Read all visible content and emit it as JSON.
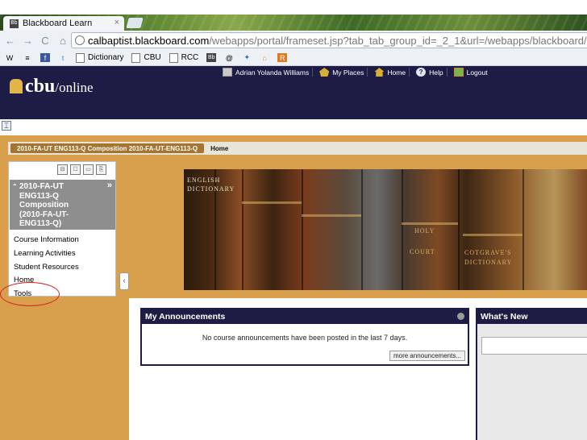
{
  "browser": {
    "tab_title": "Blackboard Learn",
    "tab_close": "×",
    "url_domain": "calbaptist.blackboard.com",
    "url_path": "/webapps/portal/frameset.jsp?tab_tab_group_id=_2_1&url=/webapps/blackboard/execute/launc",
    "nav": {
      "back": "←",
      "forward": "→",
      "reload": "C",
      "home": "⌂"
    },
    "bookmarks": [
      {
        "label": "",
        "icon": "wordpress-icon",
        "glyph": "W"
      },
      {
        "label": "",
        "icon": "rss-icon",
        "glyph": "≡"
      },
      {
        "label": "",
        "icon": "facebook-icon",
        "glyph": "f"
      },
      {
        "label": "",
        "icon": "twitter-icon",
        "glyph": "t"
      },
      {
        "label": "Dictionary",
        "icon": "page-icon",
        "glyph": ""
      },
      {
        "label": "CBU",
        "icon": "page-icon",
        "glyph": ""
      },
      {
        "label": "RCC",
        "icon": "page-icon",
        "glyph": ""
      },
      {
        "label": "",
        "icon": "bb-icon",
        "glyph": "Bb"
      },
      {
        "label": "",
        "icon": "spiral-icon",
        "glyph": "@"
      },
      {
        "label": "",
        "icon": "bird-icon",
        "glyph": "✦"
      },
      {
        "label": "",
        "icon": "building-icon",
        "glyph": "⌂"
      },
      {
        "label": "",
        "icon": "r-icon",
        "glyph": "R"
      }
    ]
  },
  "header": {
    "logo_main": "cbu",
    "logo_sub": "/online",
    "user_name": "Adrian Yolanda Williams",
    "my_places": "My Places",
    "home": "Home",
    "help": "Help",
    "help_glyph": "?",
    "logout": "Logout"
  },
  "breadcrumb": {
    "course": "2010-FA-UT ENG113-Q Composition 2010-FA-UT-ENG113-Q",
    "current": "Home"
  },
  "course_menu": {
    "tools": [
      "⊟",
      "☐",
      "▭",
      "⎘"
    ],
    "collapse": "⌃",
    "expand_glyph": "»",
    "course_title_lines": [
      "2010-FA-UT",
      "ENG113-Q",
      "Composition",
      "(2010-FA-UT-",
      "ENG113-Q)"
    ],
    "items": [
      "Course Information",
      "Learning Activities",
      "Student Resources",
      "Home",
      "Tools"
    ],
    "hide_toggle": "‹"
  },
  "expand_button": "⌶",
  "banner_labels": [
    "ENGLISH DICTIONARY",
    "HOLY",
    "COURT",
    "COTGRAVE'S DICTIONARY"
  ],
  "announcements": {
    "title": "My Announcements",
    "message": "No course announcements have been posted in the last 7 days.",
    "more": "more announcements..."
  },
  "whats_new": {
    "title": "What's New"
  },
  "colors": {
    "header_bg": "#1c1c44",
    "content_bg": "#d8a04c",
    "crumb_course_bg": "#a47531",
    "highlight_circle": "#d42020"
  }
}
